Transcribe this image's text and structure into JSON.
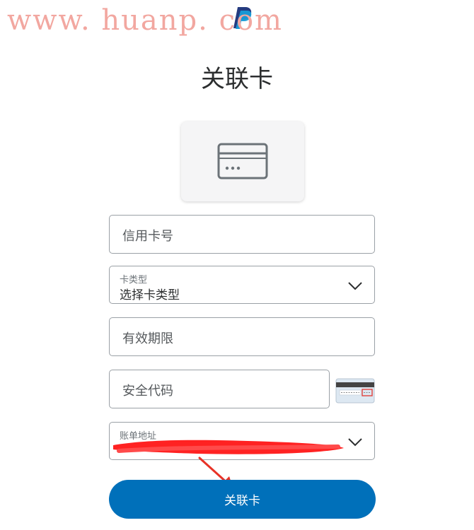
{
  "watermark": "www. huanp. com",
  "page": {
    "title": "关联卡"
  },
  "form": {
    "card_number_placeholder": "信用卡号",
    "card_type_label": "卡类型",
    "card_type_value": "选择卡类型",
    "expiry_placeholder": "有效期限",
    "security_code_placeholder": "安全代码",
    "billing_address_label": "账单地址"
  },
  "submit": {
    "label": "关联卡"
  },
  "colors": {
    "primary": "#0070ba",
    "border": "#9aa0a6",
    "redaction": "#ff2222",
    "watermark": "#f2a7a0"
  },
  "icons": {
    "brand": "paypal-logo-icon",
    "card": "credit-card-icon",
    "dropdown": "chevron-down-icon",
    "cvv": "card-back-cvv-icon",
    "annotation": "red-arrow-icon"
  }
}
